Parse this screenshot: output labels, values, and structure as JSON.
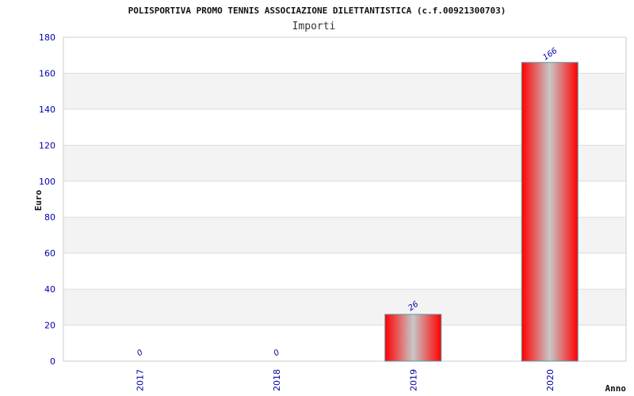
{
  "chart_data": {
    "type": "bar",
    "title": "POLISPORTIVA PROMO TENNIS ASSOCIAZIONE DILETTANTISTICA (c.f.00921300703)",
    "subtitle": "Importi",
    "xlabel": "Anno",
    "ylabel": "Euro",
    "categories": [
      "2017",
      "2018",
      "2019",
      "2020"
    ],
    "values": [
      0,
      0,
      26,
      166
    ],
    "data_labels": [
      "0",
      "0",
      "26",
      "166"
    ],
    "ylim": [
      0,
      180
    ],
    "yticks": [
      "0",
      "20",
      "40",
      "60",
      "80",
      "100",
      "120",
      "140",
      "160",
      "180"
    ],
    "grid": true,
    "colors": {
      "bar_edge": "#ff0000",
      "bar_center": "#c8c8c8",
      "bar_border": "#5599aa",
      "band": "#f3f3f3",
      "gridline": "#dddddd",
      "tick_text": "#0000aa"
    }
  }
}
